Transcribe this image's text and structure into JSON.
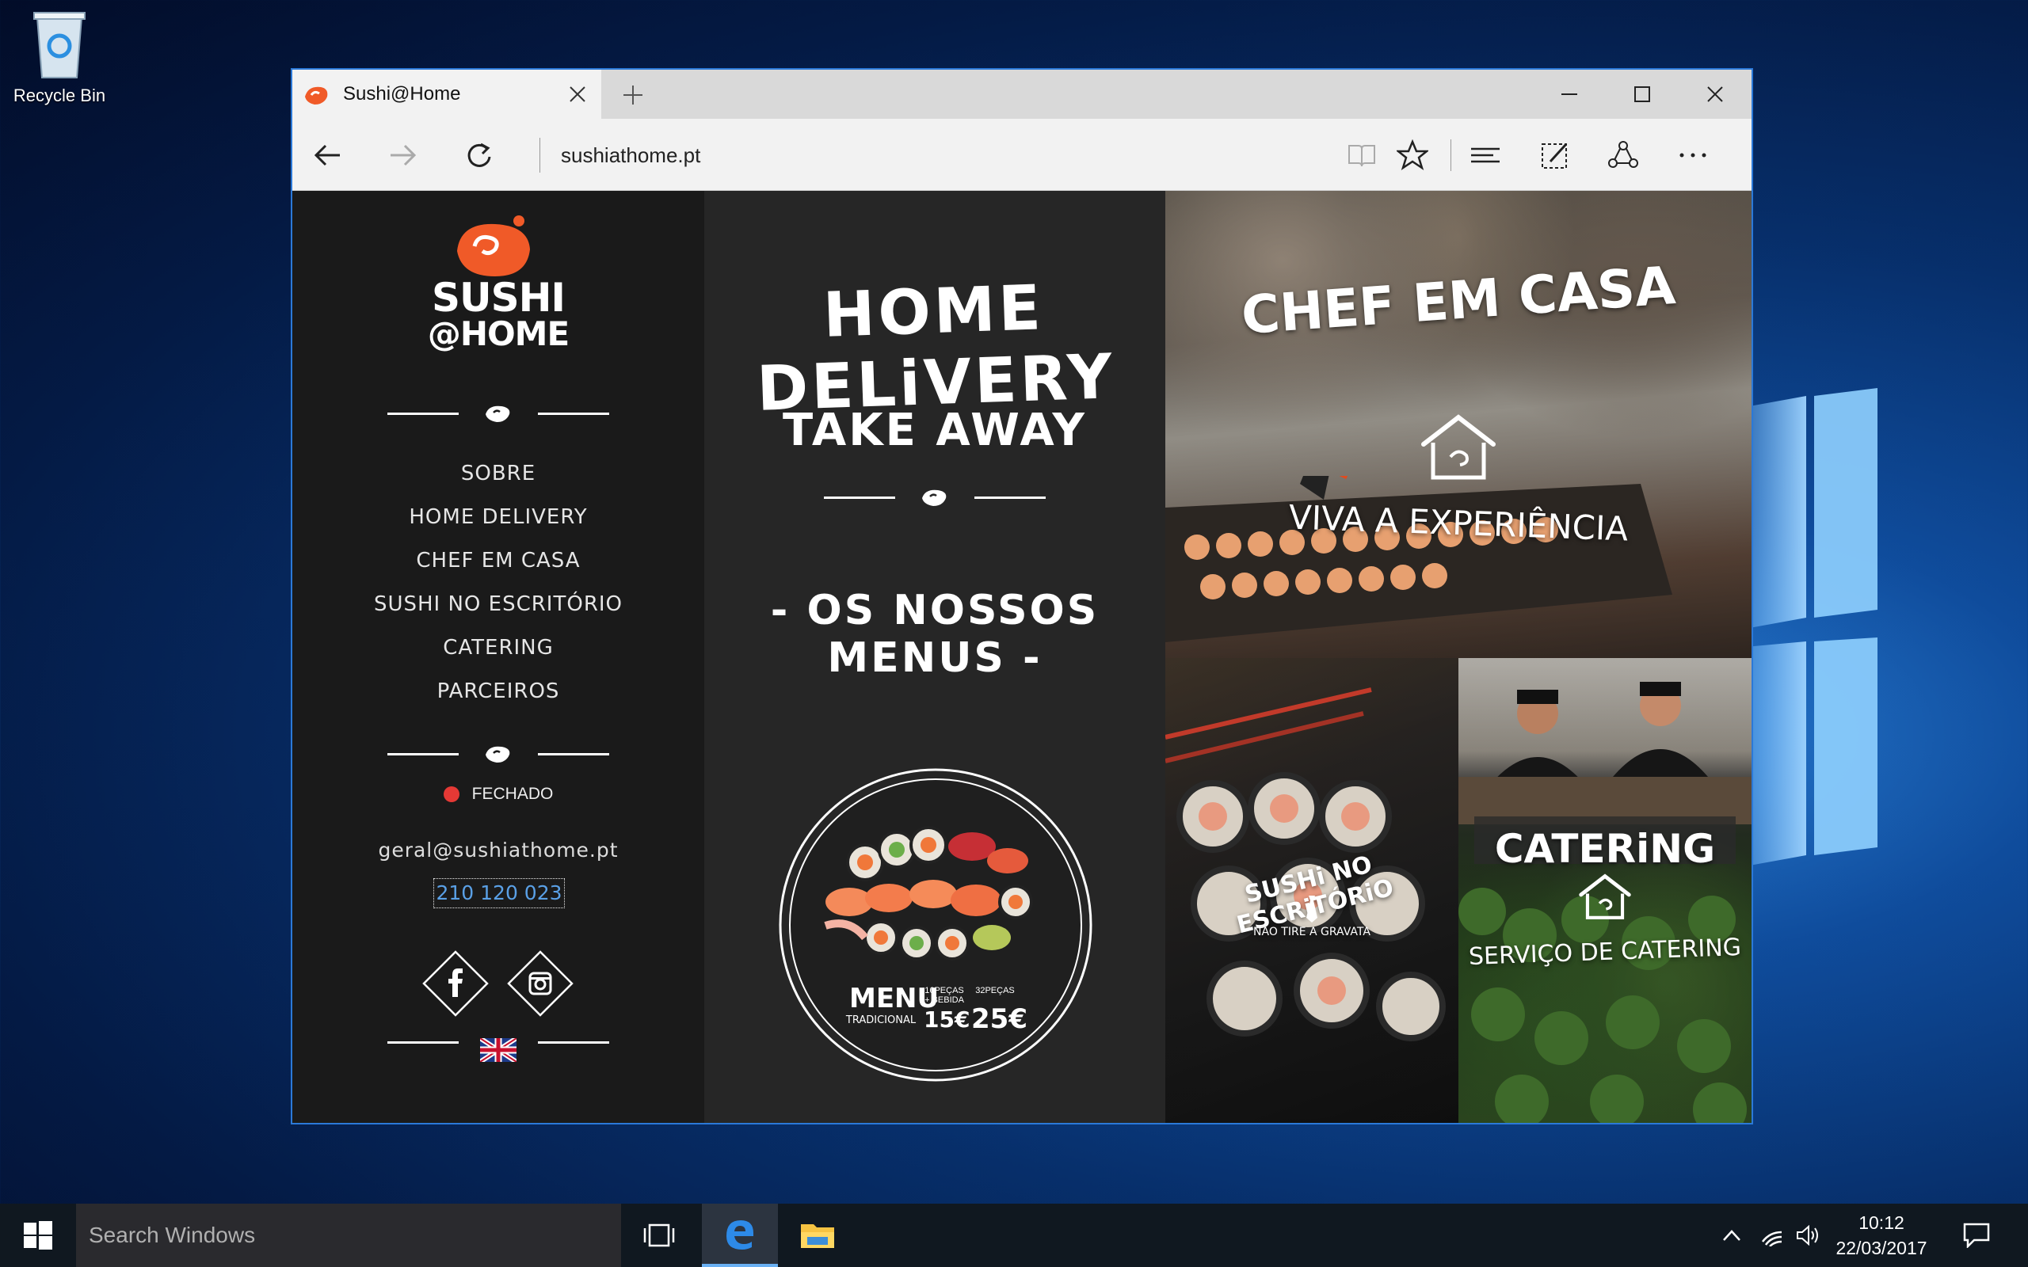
{
  "desktop": {
    "recycle_bin_label": "Recycle Bin"
  },
  "browser": {
    "tab_title": "Sushi@Home",
    "address": "sushiathome.pt"
  },
  "site": {
    "logo_line1": "SUSHI",
    "logo_line2": "@HOME",
    "nav_items": [
      "SOBRE",
      "HOME DELIVERY",
      "CHEF EM CASA",
      "SUSHI NO ESCRITÓRIO",
      "CATERING",
      "PARCEIROS"
    ],
    "status_text": "FECHADO",
    "status_color": "#e53935",
    "email": "geral@sushiathome.pt",
    "phone": "210 120 023",
    "middle": {
      "home_delivery": "HOME DELiVERY",
      "take_away": "TAKE AWAY",
      "our_menus": "- OS NOSSOS MENUS -",
      "menu_card": {
        "title": "MENU",
        "subtitle": "TRADICIONAL",
        "option1_label": "16PEÇAS + BEBIDA",
        "option1_price": "15€",
        "option2_label": "32PEÇAS",
        "option2_price": "25€"
      }
    },
    "tiles": {
      "chef_title": "CHEF EM CASA",
      "chef_sub": "VIVA A EXPERIÊNCIA",
      "office_title": "SUSHi NO ESCRiTÓRiO",
      "office_sub": "NÃO TIRE A GRAVATA",
      "catering_title": "CATERiNG",
      "catering_sub": "SERVIÇO DE CATERING"
    },
    "accent_color": "#f05a28"
  },
  "taskbar": {
    "search_placeholder": "Search Windows",
    "time": "10:12",
    "date": "22/03/2017"
  }
}
